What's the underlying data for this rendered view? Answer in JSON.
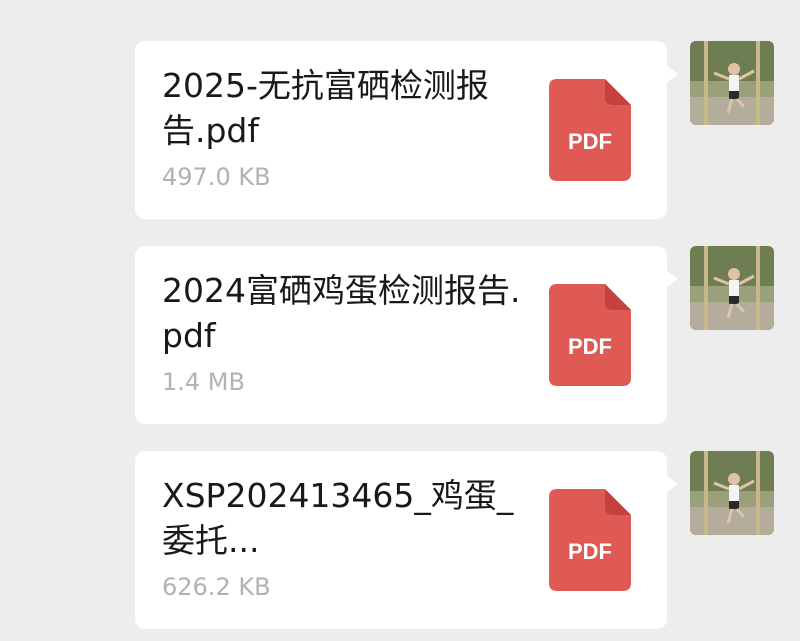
{
  "messages": [
    {
      "file_name": "2025-无抗富硒检测报告.pdf",
      "file_size": "497.0 KB",
      "file_type": "PDF",
      "icon": "pdf-file-icon"
    },
    {
      "file_name": "2024富硒鸡蛋检测报告.pdf",
      "file_size": "1.4 MB",
      "file_type": "PDF",
      "icon": "pdf-file-icon"
    },
    {
      "file_name": "XSP202413465_鸡蛋_委托...",
      "file_size": "626.2 KB",
      "file_type": "PDF",
      "icon": "pdf-file-icon"
    }
  ],
  "colors": {
    "background": "#ededed",
    "bubble": "#ffffff",
    "pdf_red": "#e05a55",
    "pdf_fold": "#c4413d",
    "size_text": "#b2b2b2"
  }
}
